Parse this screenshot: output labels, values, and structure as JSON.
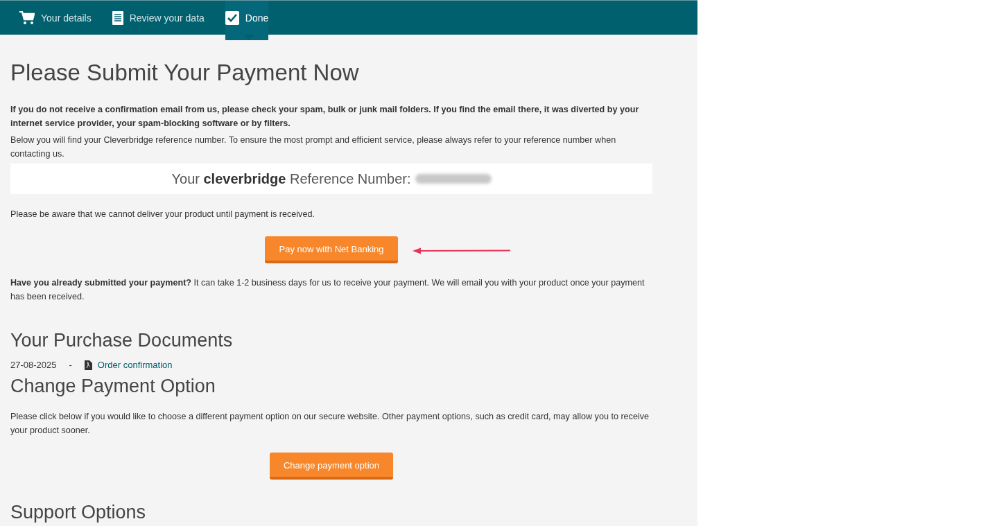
{
  "steps": [
    {
      "kind": "cart",
      "label": "Your details",
      "selected": false
    },
    {
      "kind": "document",
      "label": "Review your data",
      "selected": false
    },
    {
      "kind": "check",
      "label": "Done",
      "selected": true
    }
  ],
  "title": "Please Submit Your Payment Now",
  "notice": "If you do not receive a confirmation email from us, please check your spam, bulk or junk mail folders. If you find the email there, it was diverted by your internet service provider, your spam-blocking software or by filters.",
  "reference_intro": "Below you will find your Cleverbridge reference number. To ensure the most prompt and efficient service, please always refer to your reference number when contacting us.",
  "reference_label": "Your **cleverbridge** Reference Number:",
  "delivery_note": "Please be aware that we cannot deliver your product until payment is received.",
  "pay_button": "Pay now with Net Banking",
  "submitted_note": "**Have you already submitted your payment?** It can take 1-2 business days for us to receive your payment. We will email you with your product once your payment has been received.",
  "documents": {
    "heading": "Your Purchase Documents",
    "items": [
      {
        "date": "27-08-2025",
        "separator": "-",
        "link": "Order confirmation"
      }
    ]
  },
  "change_payment": {
    "heading": "Change Payment Option",
    "text": "Please click below if you would like to choose a different payment option on our secure website. Other payment options, such as credit card, may allow you to receive your product sooner.",
    "button": "Change payment option"
  },
  "support_heading": "Support Options"
}
